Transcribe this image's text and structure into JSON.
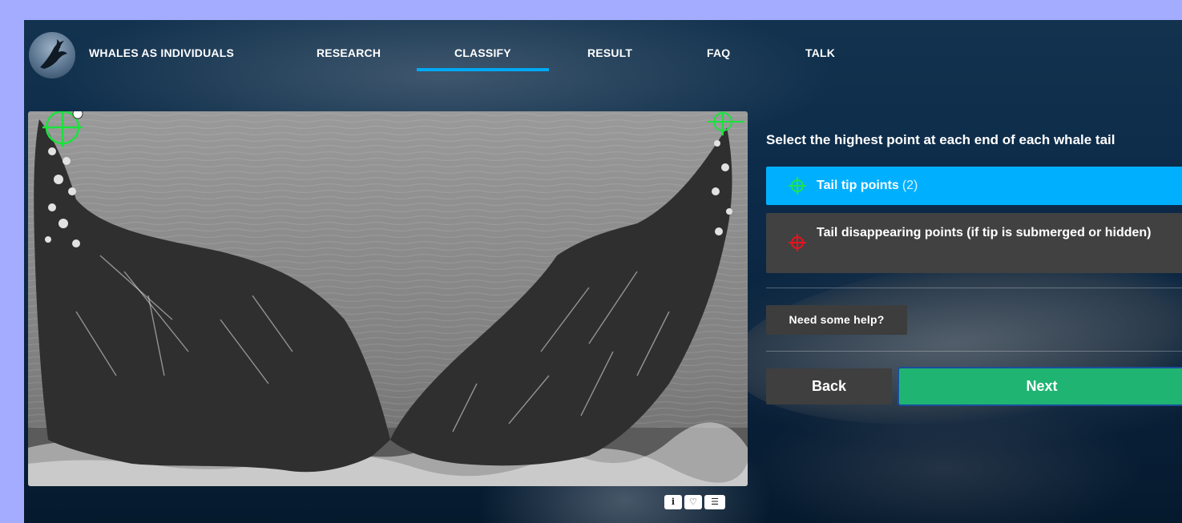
{
  "nav": {
    "logo_icon": "whale-logo-icon",
    "items": [
      {
        "label": "WHALES AS INDIVIDUALS"
      },
      {
        "label": "RESEARCH"
      },
      {
        "label": "CLASSIFY",
        "active": true
      },
      {
        "label": "RESULT"
      },
      {
        "label": "FAQ"
      },
      {
        "label": "TALK"
      }
    ]
  },
  "subject": {
    "image_icon": "whale-tail-photo",
    "markers_icon": "crosshair-marker-icon",
    "tools": [
      {
        "icon": "info-icon",
        "glyph": "i"
      },
      {
        "icon": "heart-icon",
        "glyph": "♡"
      },
      {
        "icon": "list-icon",
        "glyph": "☰"
      }
    ]
  },
  "task": {
    "instruction": "Select the highest point at each end of each whale tail",
    "options": [
      {
        "label": "Tail tip points",
        "count": "(2)",
        "color": "#1fe34a",
        "icon": "green-crosshair-icon",
        "selected": true
      },
      {
        "label": "Tail disappearing points (if tip is submerged or hidden)",
        "color": "#e8121c",
        "icon": "red-crosshair-icon",
        "selected": false
      }
    ],
    "help_label": "Need some help?",
    "back_label": "Back",
    "next_label": "Next"
  },
  "colors": {
    "page_bg": "#a3acff",
    "accent": "#00a9f4",
    "selected_option": "#00b0ff",
    "next_button": "#1fb472"
  }
}
